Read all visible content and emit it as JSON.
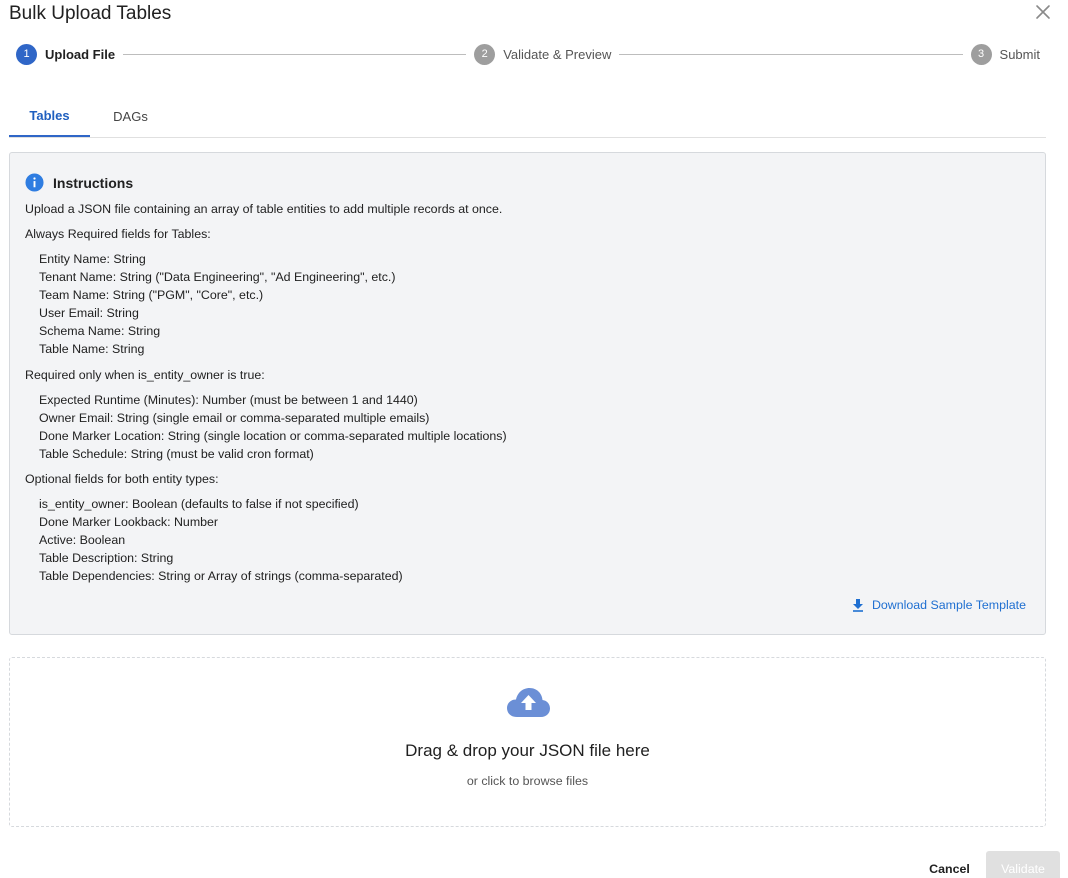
{
  "dialog": {
    "title": "Bulk Upload Tables"
  },
  "stepper": {
    "steps": [
      {
        "number": "1",
        "label": "Upload File",
        "state": "active"
      },
      {
        "number": "2",
        "label": "Validate & Preview",
        "state": "inactive"
      },
      {
        "number": "3",
        "label": "Submit",
        "state": "inactive"
      }
    ]
  },
  "tabs": [
    {
      "label": "Tables",
      "active": true
    },
    {
      "label": "DAGs",
      "active": false
    }
  ],
  "instructions": {
    "title": "Instructions",
    "intro": "Upload a JSON file containing an array of table entities to add multiple records at once.",
    "required_heading": "Always Required fields for Tables:",
    "required_fields": [
      "Entity Name: String",
      "Tenant Name: String (\"Data Engineering\", \"Ad Engineering\", etc.)",
      "Team Name: String (\"PGM\", \"Core\", etc.)",
      "User Email: String",
      "Schema Name: String",
      "Table Name: String"
    ],
    "owner_heading": "Required only when is_entity_owner is true:",
    "owner_fields": [
      "Expected Runtime (Minutes): Number (must be between 1 and 1440)",
      "Owner Email: String (single email or comma-separated multiple emails)",
      "Done Marker Location: String (single location or comma-separated multiple locations)",
      "Table Schedule: String (must be valid cron format)"
    ],
    "optional_heading": "Optional fields for both entity types:",
    "optional_fields": [
      "is_entity_owner: Boolean (defaults to false if not specified)",
      "Done Marker Lookback: Number",
      "Active: Boolean",
      "Table Description: String",
      "Table Dependencies: String or Array of strings (comma-separated)"
    ],
    "download_label": "Download Sample Template"
  },
  "dropzone": {
    "title": "Drag & drop your JSON file here",
    "subtitle": "or click to browse files"
  },
  "footer": {
    "cancel_label": "Cancel",
    "validate_label": "Validate"
  },
  "colors": {
    "accent": "#2f66c7",
    "link": "#1f6fd1",
    "panel_bg": "#f3f4f6",
    "cloud": "#6b8fd6",
    "disabled_button": "#e0e0e0"
  },
  "icons": [
    "close-icon",
    "info-icon",
    "download-icon",
    "cloud-upload-icon"
  ]
}
